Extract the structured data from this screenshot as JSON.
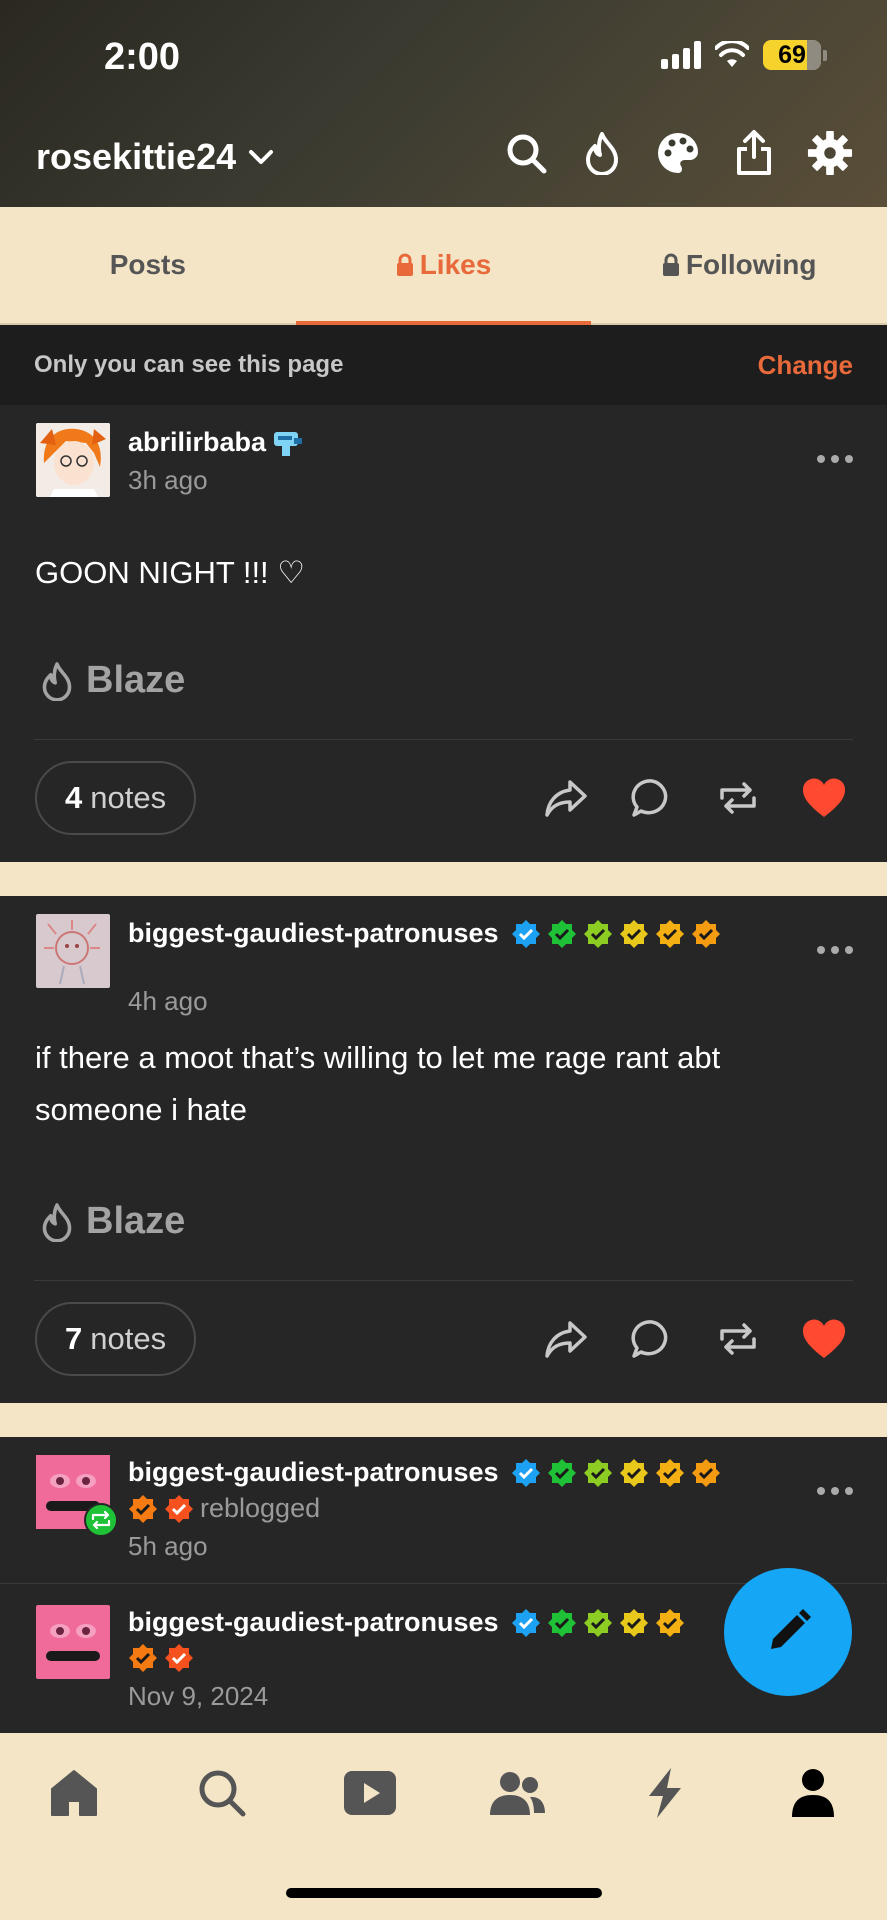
{
  "status_bar": {
    "time": "2:00",
    "battery": "69"
  },
  "header": {
    "blog_name": "rosekittie24"
  },
  "tabs": [
    {
      "label": "Posts"
    },
    {
      "label": "Likes"
    },
    {
      "label": "Following"
    }
  ],
  "privacy": {
    "message": "Only you can see this page",
    "action": "Change"
  },
  "posts": [
    {
      "author": "abrilirbaba",
      "time": "3h ago",
      "body": "GOON NIGHT !!! ♡",
      "blaze": "Blaze",
      "notes_count": "4",
      "notes_label": "notes"
    },
    {
      "author": "biggest-gaudiest-patronuses",
      "time": "4h ago",
      "body": "if there a moot that’s willing to let me rage rant abt someone i hate",
      "blaze": "Blaze",
      "notes_count": "7",
      "notes_label": "notes"
    },
    {
      "author": "biggest-gaudiest-patronuses",
      "reblog_label": "reblogged",
      "time": "5h ago"
    },
    {
      "author": "biggest-gaudiest-patronuses",
      "time": "Nov 9, 2024"
    }
  ],
  "colors": {
    "accent": "#e8693a",
    "like": "#ff4930",
    "fab": "#15a6f5",
    "badge_blue": "#1da1f2",
    "badge_green": "#1fc137",
    "badge_lime": "#8dcc22",
    "badge_yellow": "#e9c81c",
    "badge_orange": "#f49b11",
    "badge_red": "#f4511e"
  },
  "icons": [
    "search-icon",
    "fire-icon",
    "palette-icon",
    "share-icon",
    "gear-icon",
    "home-icon",
    "explore-icon",
    "video-icon",
    "communities-icon",
    "activity-icon",
    "account-icon",
    "pencil-icon"
  ]
}
